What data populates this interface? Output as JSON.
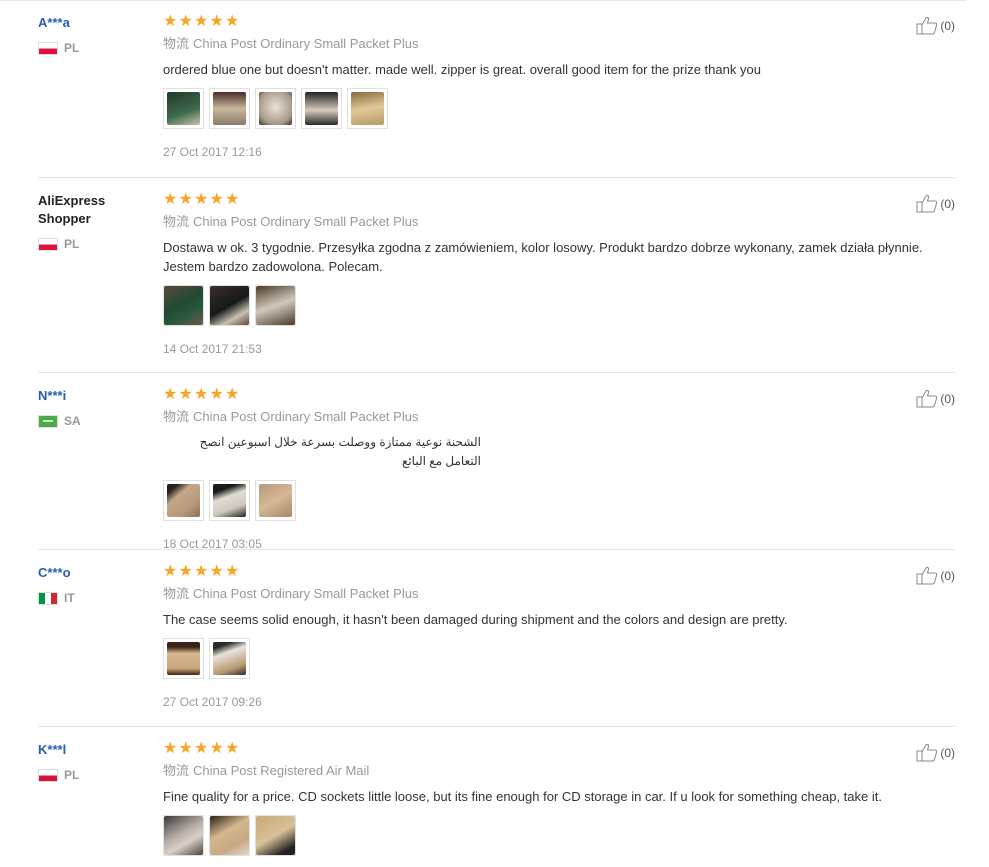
{
  "reviews": [
    {
      "user": "A***a",
      "country": "PL",
      "logistics_cn": "物流",
      "logistics": "China Post Ordinary Small Packet Plus",
      "text": "ordered blue one but doesn't matter. made well. zipper is great. overall good item for the prize thank you",
      "date": "27 Oct 2017 12:16",
      "helpful": "(0)",
      "photos": 5
    },
    {
      "user": "AliExpress Shopper",
      "country": "PL",
      "logistics_cn": "物流",
      "logistics": "China Post Ordinary Small Packet Plus",
      "text": "Dostawa w ok. 3 tygodnie. Przesyłka zgodna z zamówieniem, kolor losowy. Produkt bardzo dobrze wykonany, zamek działa płynnie. Jestem bardzo zadowolona. Polecam.",
      "date": "14 Oct 2017 21:53",
      "helpful": "(0)",
      "photos": 3
    },
    {
      "user": "N***i",
      "country": "SA",
      "logistics_cn": "物流",
      "logistics": "China Post Ordinary Small Packet Plus",
      "text": "الشحنة نوعية ممتازة ووصلت بسرعة خلال اسبوعين انصح التعامل مع البائع",
      "date": "18 Oct 2017 03:05",
      "helpful": "(0)",
      "photos": 3
    },
    {
      "user": "C***o",
      "country": "IT",
      "logistics_cn": "物流",
      "logistics": "China Post Ordinary Small Packet Plus",
      "text": "The case seems solid enough, it hasn't been damaged during shipment and the colors and design are pretty.",
      "date": "27 Oct 2017 09:26",
      "helpful": "(0)",
      "photos": 2
    },
    {
      "user": "K***l",
      "country": "PL",
      "logistics_cn": "物流",
      "logistics": "China Post Registered Air Mail",
      "text": "Fine quality for a price. CD sockets little loose, but its fine enough for CD storage in car. If u look for something cheap, take it.",
      "date": "",
      "helpful": "(0)",
      "photos": 3
    }
  ],
  "star_rating": 5,
  "colors": {
    "name_link": "#2a5db0",
    "star": "#f5a623",
    "muted": "#999999"
  }
}
